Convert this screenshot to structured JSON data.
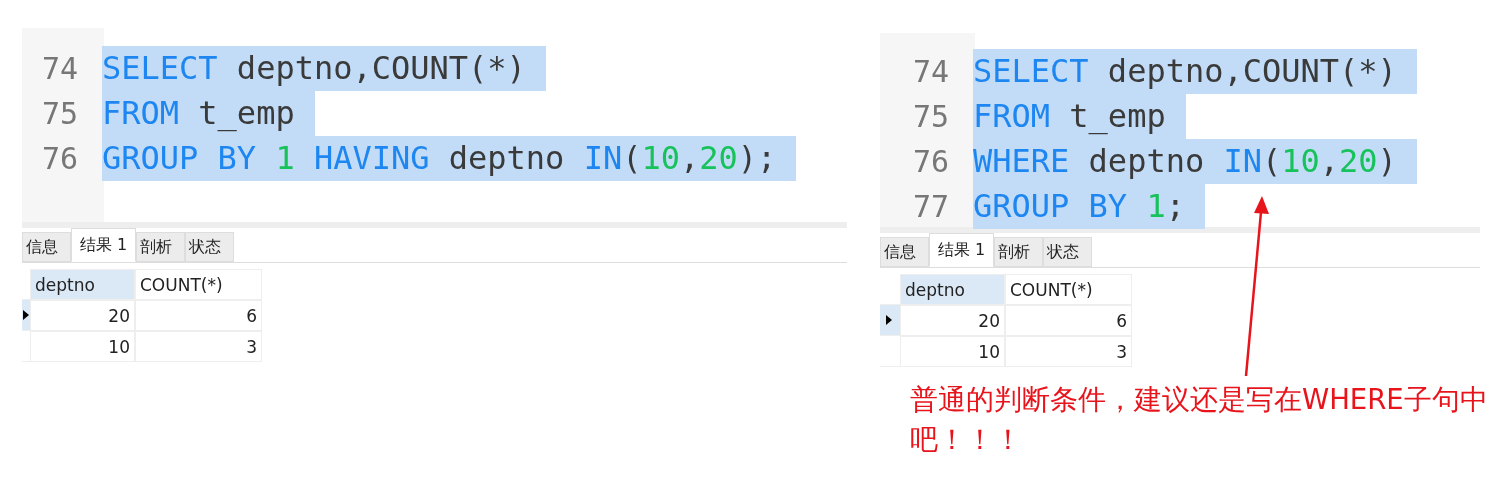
{
  "panels": [
    {
      "code_lines": [
        {
          "number": "74",
          "selected": true,
          "tokens": [
            {
              "kind": "keyword",
              "text": "SELECT"
            },
            {
              "kind": "text",
              "text": " deptno,COUNT(*)"
            }
          ]
        },
        {
          "number": "75",
          "selected": true,
          "tokens": [
            {
              "kind": "keyword",
              "text": "FROM"
            },
            {
              "kind": "text",
              "text": " t_emp"
            }
          ]
        },
        {
          "number": "76",
          "selected": true,
          "tokens": [
            {
              "kind": "keyword",
              "text": "GROUP BY "
            },
            {
              "kind": "number",
              "text": "1"
            },
            {
              "kind": "keyword",
              "text": " HAVING"
            },
            {
              "kind": "text",
              "text": " deptno "
            },
            {
              "kind": "keyword",
              "text": "IN"
            },
            {
              "kind": "text",
              "text": "("
            },
            {
              "kind": "number",
              "text": "10"
            },
            {
              "kind": "text",
              "text": ","
            },
            {
              "kind": "number",
              "text": "20"
            },
            {
              "kind": "text",
              "text": ");"
            }
          ]
        }
      ],
      "tabs": [
        {
          "label": "信息",
          "selected": false
        },
        {
          "label": "结果 1",
          "selected": true
        },
        {
          "label": "剖析",
          "selected": false
        },
        {
          "label": "状态",
          "selected": false
        }
      ],
      "columns": [
        {
          "label": "deptno",
          "selected": true
        },
        {
          "label": "COUNT(*)",
          "selected": false
        }
      ],
      "rows": [
        {
          "current": true,
          "cells": [
            "20",
            "6"
          ]
        },
        {
          "current": false,
          "cells": [
            "10",
            "3"
          ]
        }
      ]
    },
    {
      "code_lines": [
        {
          "number": "74",
          "selected": true,
          "tokens": [
            {
              "kind": "keyword",
              "text": "SELECT"
            },
            {
              "kind": "text",
              "text": " deptno,COUNT(*)"
            }
          ]
        },
        {
          "number": "75",
          "selected": true,
          "tokens": [
            {
              "kind": "keyword",
              "text": "FROM"
            },
            {
              "kind": "text",
              "text": " t_emp"
            }
          ]
        },
        {
          "number": "76",
          "selected": true,
          "tokens": [
            {
              "kind": "keyword",
              "text": "WHERE"
            },
            {
              "kind": "text",
              "text": " deptno "
            },
            {
              "kind": "keyword",
              "text": "IN"
            },
            {
              "kind": "text",
              "text": "("
            },
            {
              "kind": "number",
              "text": "10"
            },
            {
              "kind": "text",
              "text": ","
            },
            {
              "kind": "number",
              "text": "20"
            },
            {
              "kind": "text",
              "text": ")"
            }
          ]
        },
        {
          "number": "77",
          "selected": true,
          "tokens": [
            {
              "kind": "keyword",
              "text": "GROUP BY "
            },
            {
              "kind": "number",
              "text": "1"
            },
            {
              "kind": "text",
              "text": ";"
            }
          ]
        }
      ],
      "tabs": [
        {
          "label": "信息",
          "selected": false
        },
        {
          "label": "结果 1",
          "selected": true
        },
        {
          "label": "剖析",
          "selected": false
        },
        {
          "label": "状态",
          "selected": false
        }
      ],
      "columns": [
        {
          "label": "deptno",
          "selected": true
        },
        {
          "label": "COUNT(*)",
          "selected": false
        }
      ],
      "rows": [
        {
          "current": true,
          "cells": [
            "20",
            "6"
          ]
        },
        {
          "current": false,
          "cells": [
            "10",
            "3"
          ]
        }
      ],
      "annotation": "普通的判断条件，建议还是写在WHERE子句中吧！！！"
    }
  ]
}
